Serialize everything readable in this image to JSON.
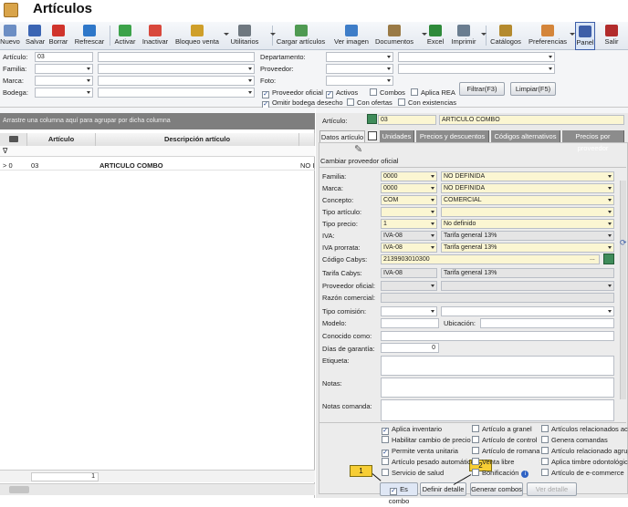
{
  "window": {
    "title": "Artículos"
  },
  "toolbar": {
    "items": [
      {
        "label": "Nuevo",
        "icon": "new-icon"
      },
      {
        "label": "Salvar",
        "icon": "save-icon"
      },
      {
        "label": "Borrar",
        "icon": "delete-icon"
      },
      {
        "label": "Refrescar",
        "icon": "refresh-icon"
      },
      {
        "label": "Activar",
        "icon": "check-icon"
      },
      {
        "label": "Inactivar",
        "icon": "inactivate-icon"
      },
      {
        "label": "Bloqueo venta",
        "icon": "lock-icon"
      },
      {
        "label": "Utilitarios",
        "icon": "tools-icon"
      },
      {
        "label": "Cargar artículos",
        "icon": "excel-load-icon"
      },
      {
        "label": "Ver imagen",
        "icon": "image-icon"
      },
      {
        "label": "Documentos",
        "icon": "documents-icon"
      },
      {
        "label": "Excel",
        "icon": "excel-icon"
      },
      {
        "label": "Imprimir",
        "icon": "print-icon"
      },
      {
        "label": "Catálogos",
        "icon": "catalogs-icon"
      },
      {
        "label": "Preferencias",
        "icon": "preferences-icon"
      },
      {
        "label": "Panel",
        "icon": "panel-icon"
      },
      {
        "label": "Salir",
        "icon": "exit-icon"
      }
    ]
  },
  "filters": {
    "articulo_label": "Artículo:",
    "articulo_value": "03",
    "familia_label": "Familia:",
    "marca_label": "Marca:",
    "bodega_label": "Bodega:",
    "departamento_label": "Departamento:",
    "proveedor_label": "Proveedor:",
    "foto_label": "Foto:",
    "checks": [
      {
        "label": "Proveedor oficial",
        "checked": true
      },
      {
        "label": "Activos",
        "checked": true
      },
      {
        "label": "Combos",
        "checked": false
      },
      {
        "label": "Aplica REA",
        "checked": false
      },
      {
        "label": "Omitir bodega desecho",
        "checked": true
      },
      {
        "label": "Con ofertas",
        "checked": false
      },
      {
        "label": "Con existencias",
        "checked": false
      }
    ],
    "filtrar_label": "Filtrar(F3)",
    "limpiar_label": "Limpiar(F5)"
  },
  "grid": {
    "group_hint": "Arrastre una columna aquí para agrupar por dicha columna",
    "col_articulo": "Artículo",
    "col_descripcion": "Descripción artículo",
    "filter_symbol": "∇",
    "rows": [
      {
        "indicator": "> 0",
        "articulo": "03",
        "descripcion": "ARTICULO COMBO",
        "extra": "NO I"
      }
    ],
    "footer_count": "1"
  },
  "detail": {
    "articulo_label": "Artículo:",
    "articulo_value": "03",
    "descripcion_value": "ARTICULO COMBO",
    "tabs": [
      "Datos artículo",
      "Unidades",
      "Precios y descuentos",
      "Códigos alternativos",
      "Precios por proveedor"
    ],
    "cambiar_label": "Cambiar proveedor oficial",
    "familia_label": "Familia:",
    "familia_code": "0000",
    "familia_desc": "NO DEFINIDA",
    "marca_label": "Marca:",
    "marca_code": "0000",
    "marca_desc": "NO DEFINIDA",
    "concepto_label": "Concepto:",
    "concepto_code": "COM",
    "concepto_desc": "COMERCIAL",
    "tipo_articulo_label": "Tipo artículo:",
    "tipo_precio_label": "Tipo precio:",
    "tipo_precio_code": "1",
    "tipo_precio_desc": "No definido",
    "iva_label": "IVA:",
    "iva_code": "IVA-08",
    "iva_desc": "Tarifa general 13%",
    "iva_prorrata_label": "IVA prorrata:",
    "iva_prorrata_code": "IVA-08",
    "iva_prorrata_desc": "Tarifa general 13%",
    "cabys_label": "Código Cabys:",
    "cabys_value": "2139903010300",
    "cabys_ellipsis": "...",
    "tarifa_cabys_label": "Tarifa Cabys:",
    "tarifa_cabys_code": "IVA-08",
    "tarifa_cabys_desc": "Tarifa general 13%",
    "proveedor_oficial_label": "Proveedor oficial:",
    "razon_label": "Razón comercial:",
    "tipo_comision_label": "Tipo comisión:",
    "modelo_label": "Modelo:",
    "ubicacion_label": "Ubicación:",
    "conocido_label": "Conocido como:",
    "garantia_label": "Días de garantía:",
    "garantia_value": "0",
    "etiqueta_label": "Etiqueta:",
    "notas_label": "Notas:",
    "notas_comanda_label": "Notas comanda:",
    "options": [
      {
        "label": "Aplica inventario",
        "checked": true
      },
      {
        "label": "Artículo a granel",
        "checked": false
      },
      {
        "label": "Artículos relacionados activos",
        "checked": false
      },
      {
        "label": "Habilitar cambio de precio",
        "checked": false
      },
      {
        "label": "Artículo de control",
        "checked": false
      },
      {
        "label": "Genera comandas",
        "checked": false
      },
      {
        "label": "Permite venta unitaria",
        "checked": true
      },
      {
        "label": "Artículo de romana",
        "checked": false
      },
      {
        "label": "Artículo relacionado agrupado",
        "checked": false
      },
      {
        "label": "Artículo pesado automático",
        "checked": false
      },
      {
        "label": "Venta libre",
        "checked": false
      },
      {
        "label": "Aplica timbre odontológico",
        "checked": false
      },
      {
        "label": "Servicio de salud",
        "checked": false
      },
      {
        "label": "Bonificación",
        "checked": false
      },
      {
        "label": "Artículo de e-commerce",
        "checked": false
      }
    ],
    "es_combo_label": "Es combo",
    "es_combo_checked": true,
    "btn_definir": "Definir detalle",
    "btn_generar": "Generar combos",
    "btn_ver": "Ver detalle",
    "callout_1": "1",
    "callout_2": "2"
  },
  "colors": {
    "accent": "#3d5ea8",
    "callout": "#f7ce35",
    "field_yellow": "#fbf6d2"
  }
}
